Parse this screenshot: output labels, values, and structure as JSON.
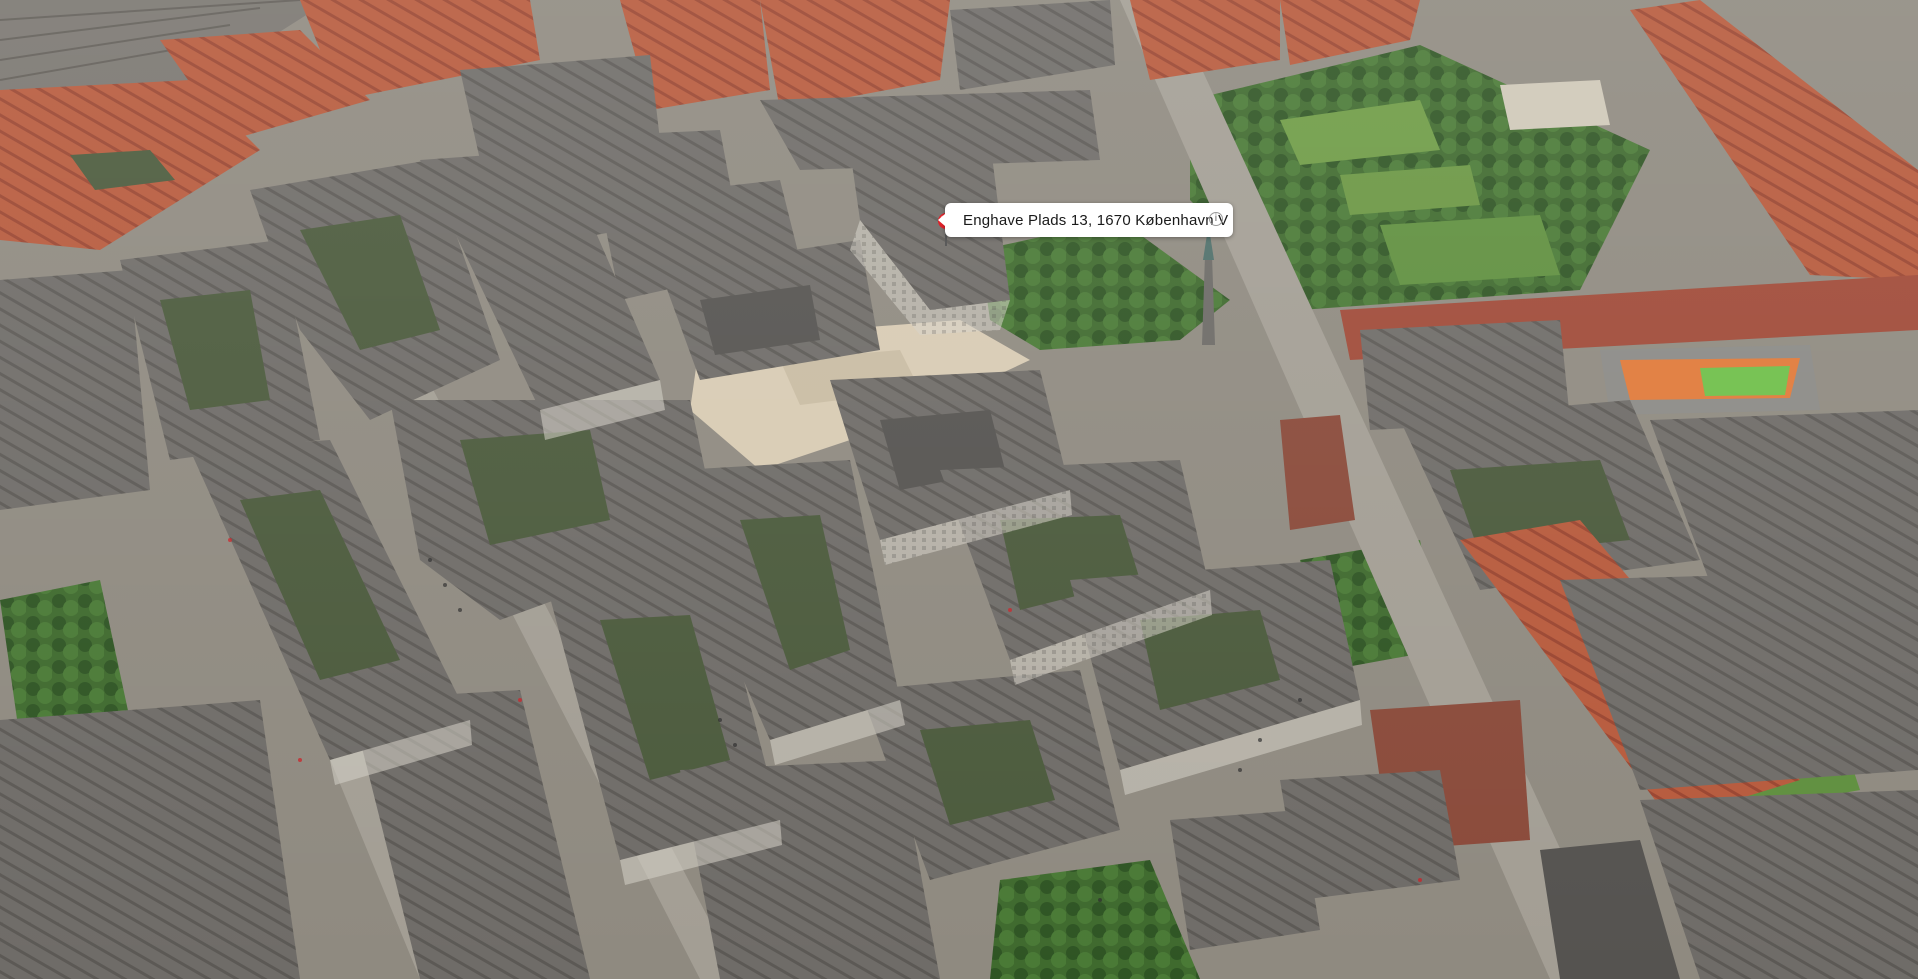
{
  "map": {
    "view": "3D satellite flyover",
    "colors": {
      "roof_grey": "#6f6c68",
      "roof_red": "#b75a3c",
      "facade_grey": "#cfcbc3",
      "facade_brick": "#8a4a3a",
      "street": "#9a958c",
      "park_green": "#3f6a2e",
      "lawn_green": "#5f8f3e",
      "courtyard": "#4b5a3c",
      "square_sand": "#d8cbb3",
      "pin_red": "#e0222a"
    }
  },
  "pin": {
    "icon": "map-pin-icon",
    "color": "#e0222a"
  },
  "callout": {
    "address": "Enghave Plads 13, 1670 København V",
    "info_icon": "info-circle-icon",
    "info_symbol": "i"
  }
}
